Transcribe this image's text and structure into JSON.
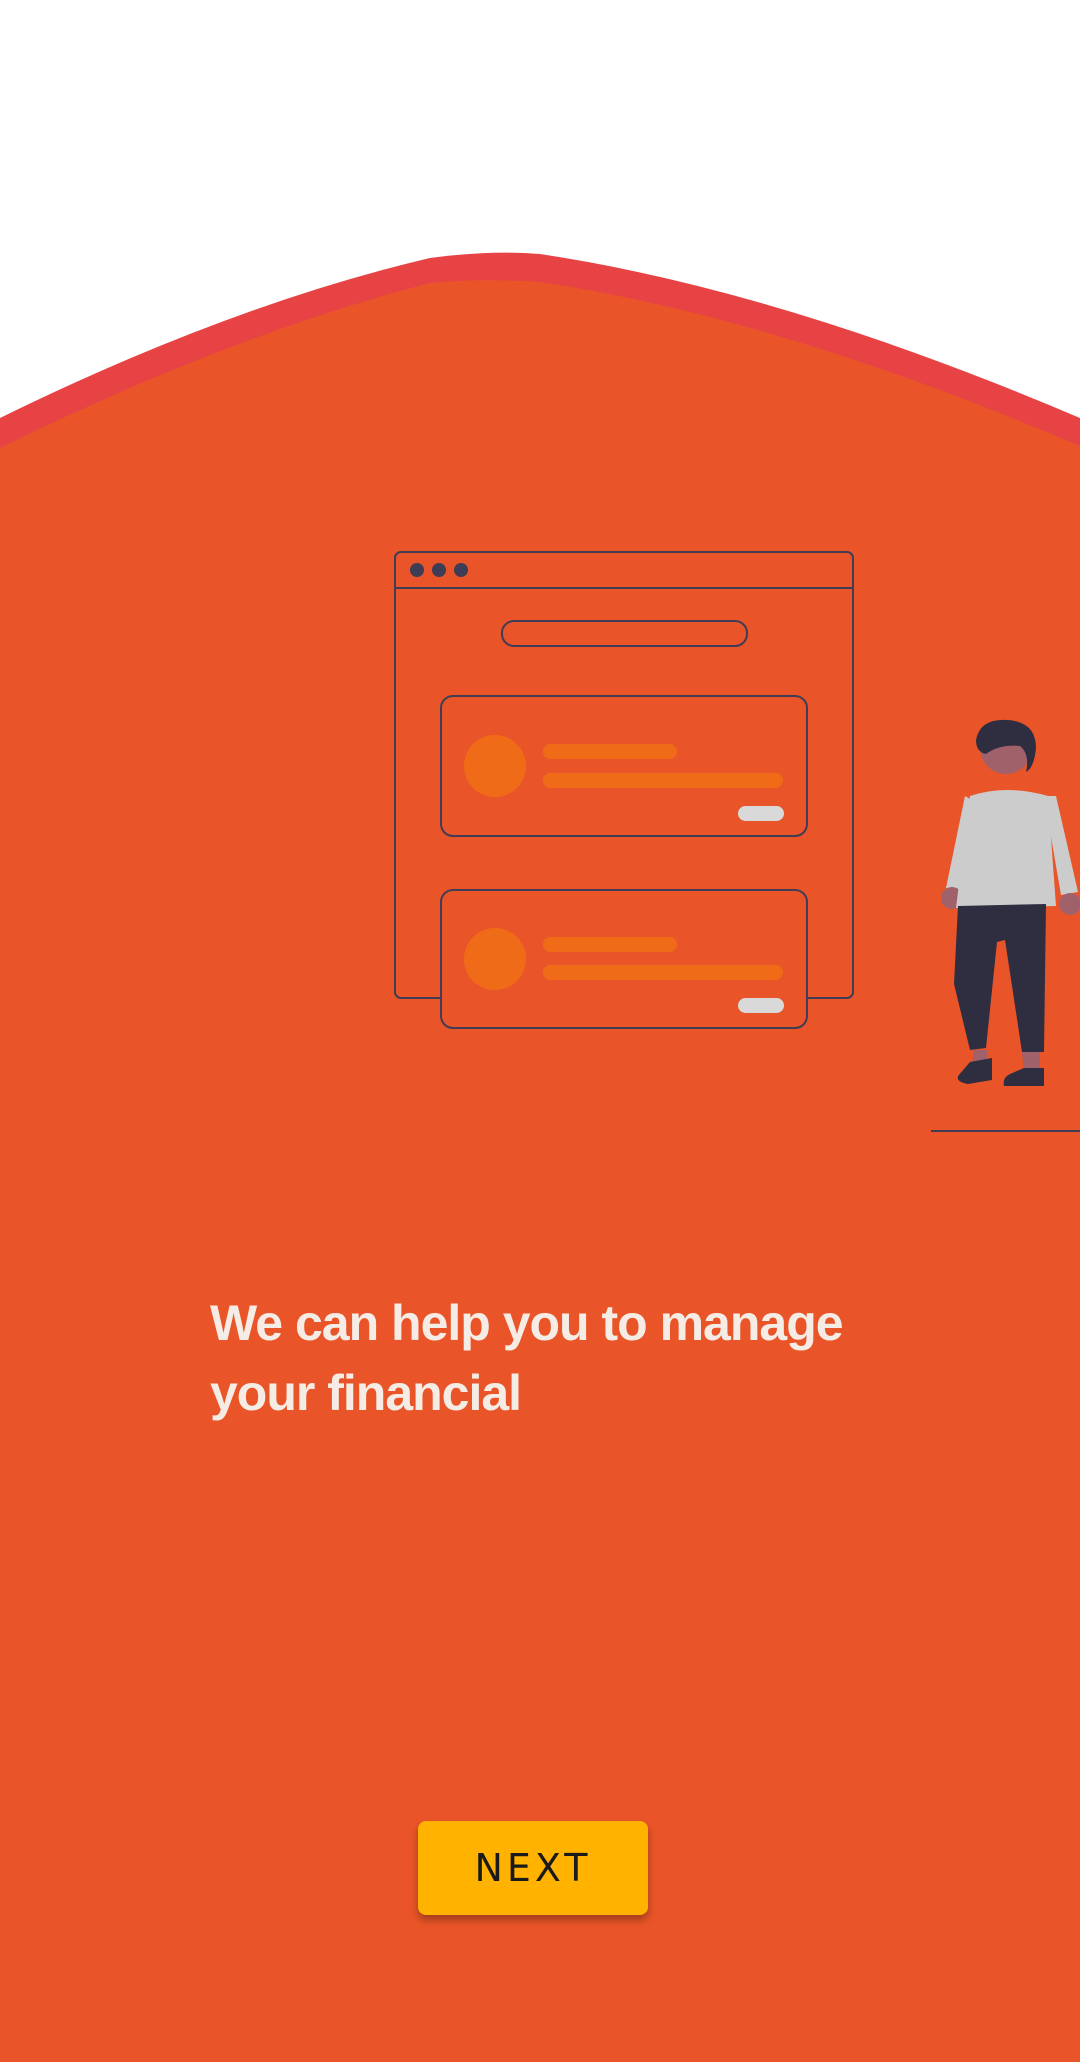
{
  "onboarding": {
    "headline": "We can help you to manage your financial",
    "next_button_label": "NEXT"
  },
  "icons": {
    "illustration": "browser-window-with-cards-and-person-illustration"
  },
  "colors": {
    "background_top": "#ffffff",
    "wave_accent": "#e84344",
    "background": "#e95528",
    "button": "#ffb300",
    "illustration_line": "#3f3d56",
    "card_accent": "#f06b18"
  }
}
